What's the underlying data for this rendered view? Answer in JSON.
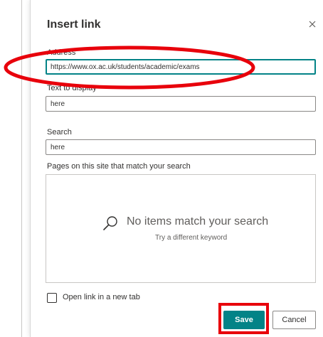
{
  "dialog": {
    "title": "Insert link",
    "close_icon": "close-icon"
  },
  "address": {
    "label": "Address",
    "value": "https://www.ox.ac.uk/students/academic/exams"
  },
  "text_to_display": {
    "label": "Text to display",
    "value": "here"
  },
  "search": {
    "label": "Search",
    "value": "here"
  },
  "results": {
    "label": "Pages on this site that match your search",
    "empty_message": "No items match your search",
    "empty_hint": "Try a different keyword",
    "icon": "search-icon"
  },
  "options": {
    "new_tab_label": "Open link in a new tab",
    "new_tab_checked": false
  },
  "buttons": {
    "save": "Save",
    "cancel": "Cancel"
  },
  "colors": {
    "accent": "#038387",
    "annotation": "#e8000b"
  }
}
